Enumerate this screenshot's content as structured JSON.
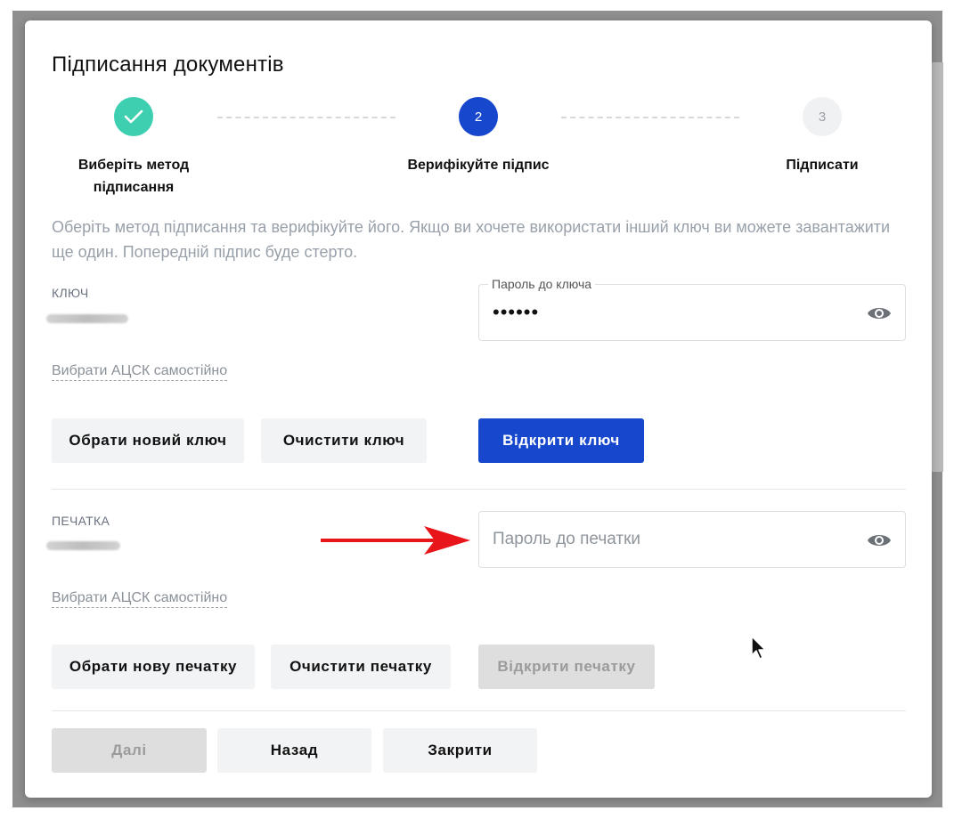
{
  "modal": {
    "title": "Підписання документів"
  },
  "stepper": {
    "steps": [
      {
        "number": "",
        "label": "Виберіть метод підписання",
        "state": "done"
      },
      {
        "number": "2",
        "label": "Верифікуйте підпис",
        "state": "active"
      },
      {
        "number": "3",
        "label": "Підписати",
        "state": "todo"
      }
    ]
  },
  "description": "Оберіть метод підписання та верифікуйте його. Якщо ви хочете використати інший ключ ви можете завантажити ще один. Попередній підпис буде стерто.",
  "key_section": {
    "caption": "КЛЮЧ",
    "password_label": "Пароль до ключа",
    "password_value": "••••••",
    "choose_acsk_link": "Вибрати АЦСК самостійно",
    "buttons": {
      "new_key": "Обрати новий ключ",
      "clear_key": "Очистити ключ",
      "open_key": "Відкрити ключ"
    }
  },
  "stamp_section": {
    "caption": "ПЕЧАТКА",
    "password_placeholder": "Пароль до печатки",
    "choose_acsk_link": "Вибрати АЦСК самостійно",
    "buttons": {
      "new_stamp": "Обрати нову печатку",
      "clear_stamp": "Очистити печатку",
      "open_stamp": "Відкрити печатку"
    }
  },
  "footer": {
    "next": "Далі",
    "back": "Назад",
    "close": "Закрити"
  },
  "colors": {
    "primary": "#1747cc",
    "success": "#3ecfb0",
    "annotation_arrow": "#e8161b"
  },
  "icons": [
    "check-icon",
    "eye-icon",
    "arrow-annotation",
    "mouse-pointer-icon"
  ]
}
